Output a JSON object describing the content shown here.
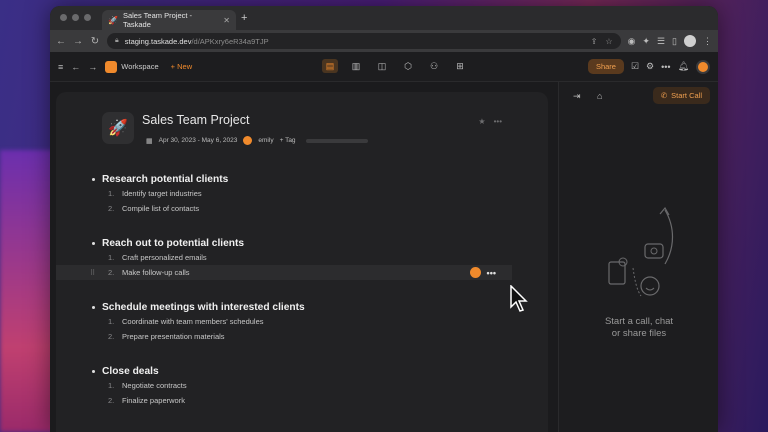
{
  "browser": {
    "tab_title": "Sales Team Project - Taskade",
    "url_host": "staging.taskade.dev",
    "url_path": "/d/APKxry6eR34a9TJP"
  },
  "app_toolbar": {
    "workspace_label": "Workspace",
    "new_label": "+ New",
    "share_label": "Share"
  },
  "project": {
    "title": "Sales Team Project",
    "date_range": "Apr 30, 2023 - May 6, 2023",
    "assignee": "emily",
    "tag_label": "+ Tag",
    "sections": [
      {
        "heading": "Research potential clients",
        "items": [
          {
            "num": "1.",
            "text": "Identify target industries"
          },
          {
            "num": "2.",
            "text": "Compile list of contacts"
          }
        ]
      },
      {
        "heading": "Reach out to potential clients",
        "items": [
          {
            "num": "1.",
            "text": "Craft personalized emails"
          },
          {
            "num": "2.",
            "text": "Make follow-up calls"
          }
        ]
      },
      {
        "heading": "Schedule meetings with interested clients",
        "items": [
          {
            "num": "1.",
            "text": "Coordinate with team members' schedules"
          },
          {
            "num": "2.",
            "text": "Prepare presentation materials"
          }
        ]
      },
      {
        "heading": "Close deals",
        "items": [
          {
            "num": "1.",
            "text": "Negotiate contracts"
          },
          {
            "num": "2.",
            "text": "Finalize paperwork"
          }
        ]
      }
    ]
  },
  "right_panel": {
    "start_call_label": "Start Call",
    "empty_line1": "Start a call, chat",
    "empty_line2": "or share files"
  },
  "colors": {
    "accent": "#f08a2c",
    "panel": "#222224",
    "background": "#1b1b1d"
  }
}
